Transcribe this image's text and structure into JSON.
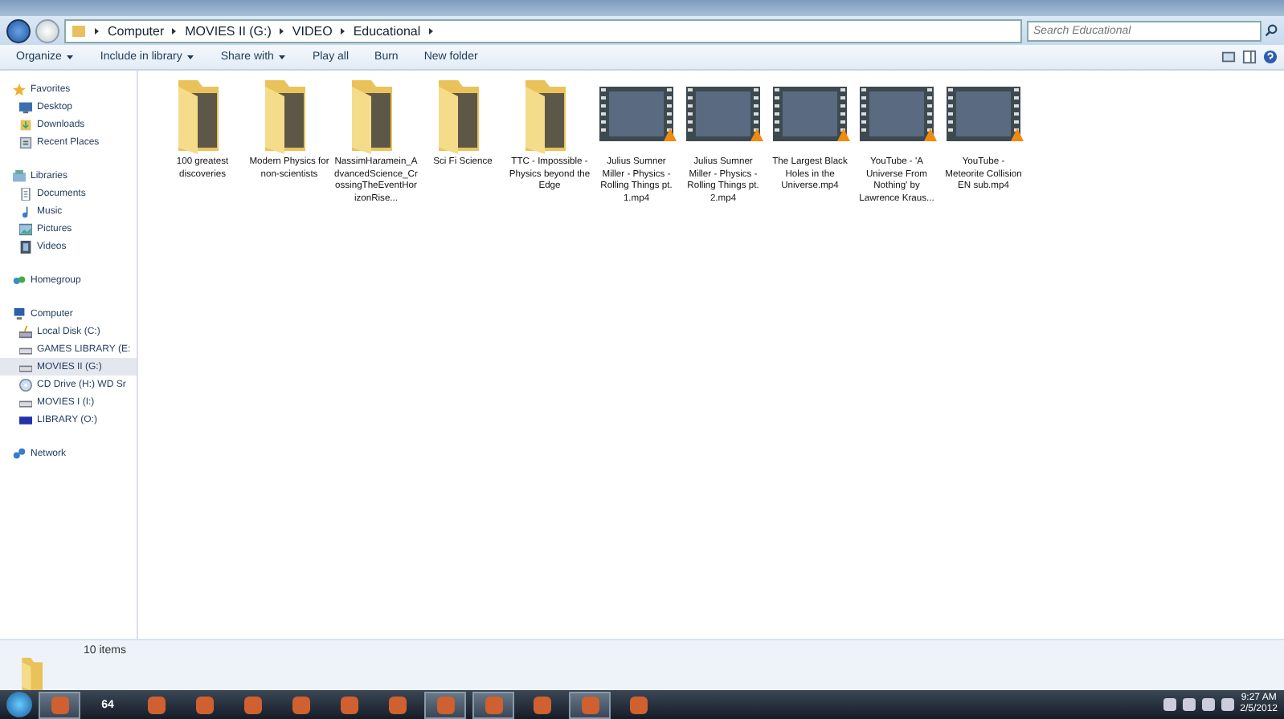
{
  "address_bar": {
    "path": [
      "Computer",
      "MOVIES II (G:)",
      "VIDEO",
      "Educational"
    ],
    "search_placeholder": "Search Educational"
  },
  "toolbar": {
    "buttons": [
      {
        "label": "Organize",
        "dropdown": true
      },
      {
        "label": "Include in library",
        "dropdown": true
      },
      {
        "label": "Share with",
        "dropdown": true
      },
      {
        "label": "Play all",
        "dropdown": false
      },
      {
        "label": "Burn",
        "dropdown": false
      },
      {
        "label": "New folder",
        "dropdown": false
      }
    ]
  },
  "sidebar": {
    "groups": [
      {
        "label": "Favorites",
        "kind": "star",
        "children": [
          {
            "label": "Desktop",
            "kind": "desktop",
            "selected": false
          },
          {
            "label": "Downloads",
            "kind": "download",
            "selected": false
          },
          {
            "label": "Recent Places",
            "kind": "recent",
            "selected": false
          }
        ]
      },
      {
        "label": "Libraries",
        "kind": "library",
        "children": [
          {
            "label": "Documents",
            "kind": "doc",
            "selected": false
          },
          {
            "label": "Music",
            "kind": "music",
            "selected": false
          },
          {
            "label": "Pictures",
            "kind": "picture",
            "selected": false
          },
          {
            "label": "Videos",
            "kind": "video",
            "selected": false
          }
        ]
      },
      {
        "label": "Homegroup",
        "kind": "homegroup"
      },
      {
        "label": "Computer",
        "kind": "computer",
        "children": [
          {
            "label": "Local Disk (C:)",
            "kind": "disk",
            "selected": false
          },
          {
            "label": "GAMES LIBRARY (E:",
            "kind": "drive",
            "selected": false
          },
          {
            "label": "MOVIES II (G:)",
            "kind": "drive",
            "selected": true
          },
          {
            "label": "CD Drive (H:) WD Sr",
            "kind": "cd",
            "selected": false
          },
          {
            "label": "MOVIES I (I:)",
            "kind": "drive",
            "selected": false
          },
          {
            "label": "LIBRARY (O:)",
            "kind": "wd",
            "selected": false
          }
        ]
      },
      {
        "label": "Network",
        "kind": "network"
      }
    ]
  },
  "files": [
    {
      "name": "100 greatest discoveries",
      "kind": "folder"
    },
    {
      "name": "Modern Physics for non-scientists",
      "kind": "folder"
    },
    {
      "name": "NassimHaramein_AdvancedScience_CrossingTheEventHorizonRise...",
      "kind": "folder"
    },
    {
      "name": "Sci Fi Science",
      "kind": "folder"
    },
    {
      "name": "TTC - Impossible - Physics beyond the Edge",
      "kind": "folder"
    },
    {
      "name": "Julius Sumner Miller - Physics -Rolling Things pt. 1.mp4",
      "kind": "video"
    },
    {
      "name": "Julius Sumner Miller - Physics -Rolling Things pt. 2.mp4",
      "kind": "video"
    },
    {
      "name": "The Largest Black Holes in the Universe.mp4",
      "kind": "video"
    },
    {
      "name": "YouTube - 'A Universe From Nothing' by Lawrence Kraus...",
      "kind": "video"
    },
    {
      "name": "YouTube - Meteorite Collision EN sub.mp4",
      "kind": "video"
    }
  ],
  "details": {
    "count": "10 items"
  },
  "taskbar": {
    "apps": [
      {
        "active": true
      },
      {
        "label": "64",
        "active": false
      },
      {
        "active": false
      },
      {
        "active": false
      },
      {
        "active": false
      },
      {
        "active": false
      },
      {
        "active": false
      },
      {
        "active": false
      },
      {
        "active": true
      },
      {
        "active": true
      },
      {
        "active": false
      },
      {
        "active": true
      },
      {
        "active": false
      }
    ],
    "time": "9:27 AM",
    "date": "2/5/2012"
  }
}
